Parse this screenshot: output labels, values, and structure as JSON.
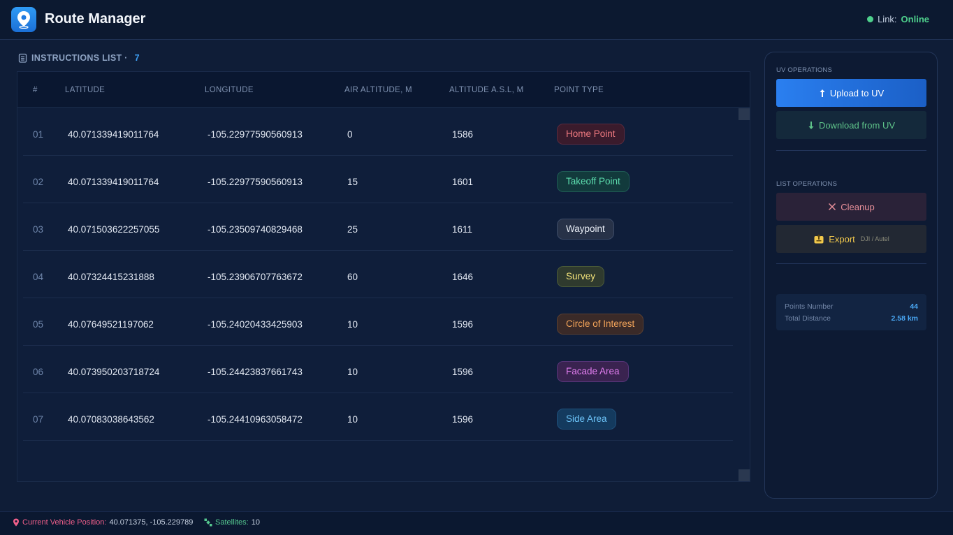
{
  "app": {
    "title": "Route Manager",
    "link_label": "Link:",
    "link_value": "Online"
  },
  "list": {
    "heading": "INSTRUCTIONS LIST ·",
    "count": "7",
    "columns": [
      "#",
      "LATITUDE",
      "LONGITUDE",
      "AIR ALTITUDE, M",
      "ALTITUDE A.S.L, M",
      "POINT TYPE"
    ],
    "rows": [
      {
        "idx": "01",
        "lat": "40.071339419011764",
        "lon": "-105.22977590560913",
        "air": "0",
        "asl": "1586",
        "type": "Home Point"
      },
      {
        "idx": "02",
        "lat": "40.071339419011764",
        "lon": "-105.22977590560913",
        "air": "15",
        "asl": "1601",
        "type": "Takeoff Point"
      },
      {
        "idx": "03",
        "lat": "40.071503622257055",
        "lon": "-105.23509740829468",
        "air": "25",
        "asl": "1611",
        "type": "Waypoint"
      },
      {
        "idx": "04",
        "lat": "40.07324415231888",
        "lon": "-105.23906707763672",
        "air": "60",
        "asl": "1646",
        "type": "Survey"
      },
      {
        "idx": "05",
        "lat": "40.07649521197062",
        "lon": "-105.24020433425903",
        "air": "10",
        "asl": "1596",
        "type": "Circle of Interest"
      },
      {
        "idx": "06",
        "lat": "40.073950203718724",
        "lon": "-105.24423837661743",
        "air": "10",
        "asl": "1596",
        "type": "Facade Area"
      },
      {
        "idx": "07",
        "lat": "40.07083038643562",
        "lon": "-105.24410963058472",
        "air": "10",
        "asl": "1596",
        "type": "Side Area"
      }
    ]
  },
  "side": {
    "uv_section": "UV OPERATIONS",
    "upload": "Upload to UV",
    "download": "Download from UV",
    "list_section": "LIST OPERATIONS",
    "cleanup": "Cleanup",
    "export": "Export",
    "export_sub": "DJI / Autel",
    "points_label": "Points Number",
    "points_value": "44",
    "distance_label": "Total Distance",
    "distance_value": "2.58 km"
  },
  "footer": {
    "position_label": "Current Vehicle Position:",
    "position_value": "40.071375, -105.229789",
    "satellites_label": "Satellites:",
    "satellites_value": "10"
  },
  "colors": {
    "accent": "#2a7ff0",
    "online": "#4ed08c"
  }
}
